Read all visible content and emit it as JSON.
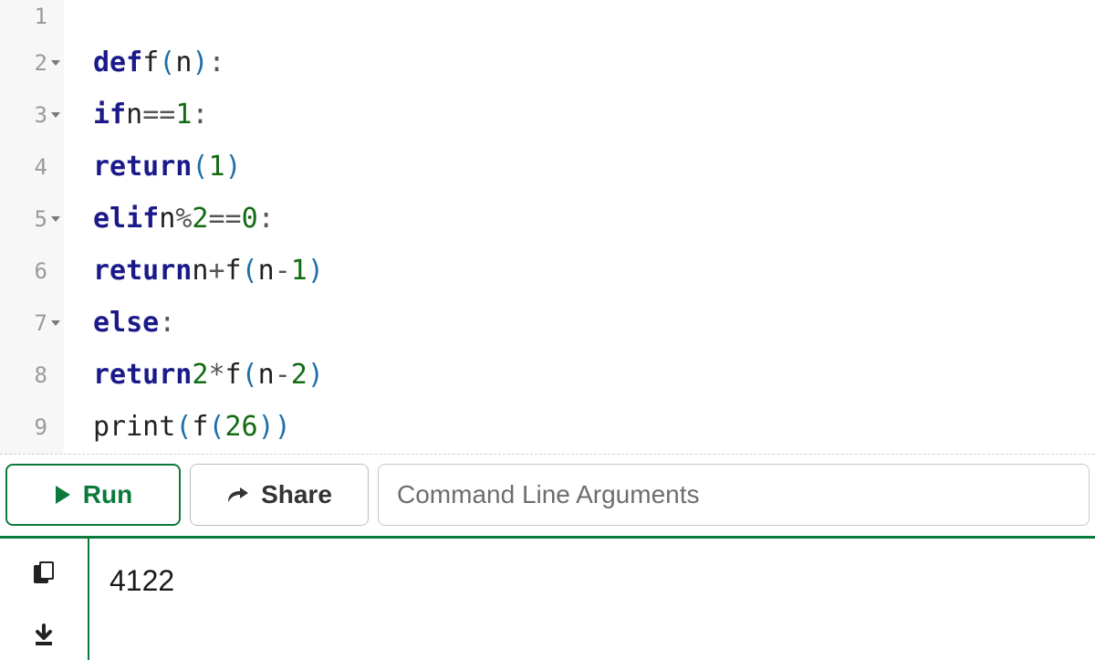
{
  "editor": {
    "lines": [
      {
        "num": "1",
        "fold": false,
        "tokens": []
      },
      {
        "num": "2",
        "fold": true,
        "tokens": [
          {
            "t": "kw",
            "v": "def"
          },
          {
            "t": "sp",
            "v": " "
          },
          {
            "t": "fn",
            "v": "f"
          },
          {
            "t": "par",
            "v": "("
          },
          {
            "t": "name",
            "v": "n"
          },
          {
            "t": "par",
            "v": ")"
          },
          {
            "t": "op",
            "v": ":"
          }
        ]
      },
      {
        "num": "3",
        "fold": true,
        "tokens": [
          {
            "t": "ind",
            "v": 1
          },
          {
            "t": "sp",
            "v": "    "
          },
          {
            "t": "kw",
            "v": "if"
          },
          {
            "t": "sp",
            "v": " "
          },
          {
            "t": "name",
            "v": "n"
          },
          {
            "t": "sp",
            "v": " "
          },
          {
            "t": "op",
            "v": "=="
          },
          {
            "t": "sp",
            "v": " "
          },
          {
            "t": "num",
            "v": "1"
          },
          {
            "t": "op",
            "v": ":"
          }
        ]
      },
      {
        "num": "4",
        "fold": false,
        "tokens": [
          {
            "t": "ind",
            "v": 2
          },
          {
            "t": "sp",
            "v": "        "
          },
          {
            "t": "kw",
            "v": "return"
          },
          {
            "t": "par",
            "v": "("
          },
          {
            "t": "num",
            "v": "1"
          },
          {
            "t": "par",
            "v": ")"
          }
        ]
      },
      {
        "num": "5",
        "fold": true,
        "tokens": [
          {
            "t": "ind",
            "v": 1
          },
          {
            "t": "sp",
            "v": "    "
          },
          {
            "t": "kw",
            "v": "elif"
          },
          {
            "t": "sp",
            "v": " "
          },
          {
            "t": "name",
            "v": "n"
          },
          {
            "t": "sp",
            "v": " "
          },
          {
            "t": "op",
            "v": "%"
          },
          {
            "t": "sp",
            "v": " "
          },
          {
            "t": "num",
            "v": "2"
          },
          {
            "t": "sp",
            "v": " "
          },
          {
            "t": "op",
            "v": "=="
          },
          {
            "t": "sp",
            "v": " "
          },
          {
            "t": "num",
            "v": "0"
          },
          {
            "t": "op",
            "v": ":"
          }
        ]
      },
      {
        "num": "6",
        "fold": false,
        "tokens": [
          {
            "t": "ind",
            "v": 2
          },
          {
            "t": "sp",
            "v": "        "
          },
          {
            "t": "kw",
            "v": "return"
          },
          {
            "t": "sp",
            "v": " "
          },
          {
            "t": "name",
            "v": "n"
          },
          {
            "t": "sp",
            "v": " "
          },
          {
            "t": "op",
            "v": "+"
          },
          {
            "t": "sp",
            "v": " "
          },
          {
            "t": "fn",
            "v": "f"
          },
          {
            "t": "par",
            "v": "("
          },
          {
            "t": "name",
            "v": "n"
          },
          {
            "t": "op",
            "v": "-"
          },
          {
            "t": "num",
            "v": "1"
          },
          {
            "t": "par",
            "v": ")"
          }
        ]
      },
      {
        "num": "7",
        "fold": true,
        "tokens": [
          {
            "t": "ind",
            "v": 1
          },
          {
            "t": "sp",
            "v": "    "
          },
          {
            "t": "kw",
            "v": "else"
          },
          {
            "t": "op",
            "v": ":"
          }
        ]
      },
      {
        "num": "8",
        "fold": false,
        "tokens": [
          {
            "t": "ind",
            "v": 2
          },
          {
            "t": "sp",
            "v": "        "
          },
          {
            "t": "kw",
            "v": "return"
          },
          {
            "t": "sp",
            "v": " "
          },
          {
            "t": "num",
            "v": "2"
          },
          {
            "t": "sp",
            "v": " "
          },
          {
            "t": "op",
            "v": "*"
          },
          {
            "t": "sp",
            "v": " "
          },
          {
            "t": "fn",
            "v": "f"
          },
          {
            "t": "par",
            "v": "("
          },
          {
            "t": "name",
            "v": "n"
          },
          {
            "t": "op",
            "v": "-"
          },
          {
            "t": "num",
            "v": "2"
          },
          {
            "t": "par",
            "v": ")"
          }
        ]
      },
      {
        "num": "9",
        "fold": false,
        "tokens": [
          {
            "t": "fn",
            "v": "print"
          },
          {
            "t": "par",
            "v": "("
          },
          {
            "t": "fn",
            "v": "f"
          },
          {
            "t": "par",
            "v": "("
          },
          {
            "t": "num",
            "v": "26"
          },
          {
            "t": "par",
            "v": ")"
          },
          {
            "t": "par",
            "v": ")"
          }
        ]
      }
    ]
  },
  "toolbar": {
    "run_label": "Run",
    "share_label": "Share",
    "cli_placeholder": "Command Line Arguments",
    "cli_value": ""
  },
  "output": {
    "text": "4122"
  },
  "colors": {
    "accent_green": "#0a7a3b"
  }
}
